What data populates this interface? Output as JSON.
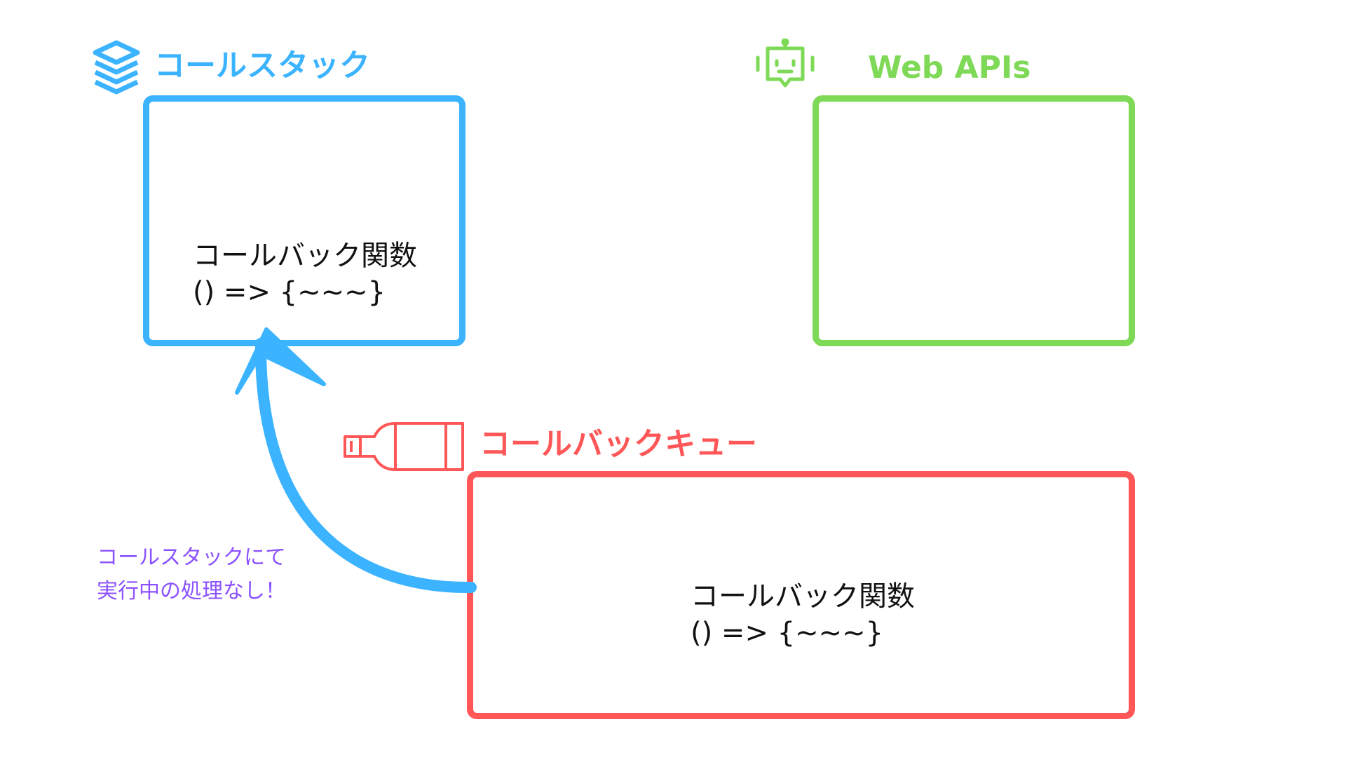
{
  "colors": {
    "call_stack": "#3bb3ff",
    "web_apis": "#7ed957",
    "callback_queue": "#ff5757",
    "note": "#8c52ff",
    "text": "#111111"
  },
  "call_stack": {
    "icon": "layers-icon",
    "title": "コールスタック",
    "item": {
      "label": "コールバック関数",
      "code": "() => {~~~}"
    }
  },
  "web_apis": {
    "icon": "robot-icon",
    "title": "Web APIs"
  },
  "callback_queue": {
    "icon": "battery-icon",
    "title": "コールバックキュー",
    "item": {
      "label": "コールバック関数",
      "code": "() => {~~~}"
    }
  },
  "annotation": {
    "line1": "コールスタックにて",
    "line2": "実行中の処理なし！"
  }
}
